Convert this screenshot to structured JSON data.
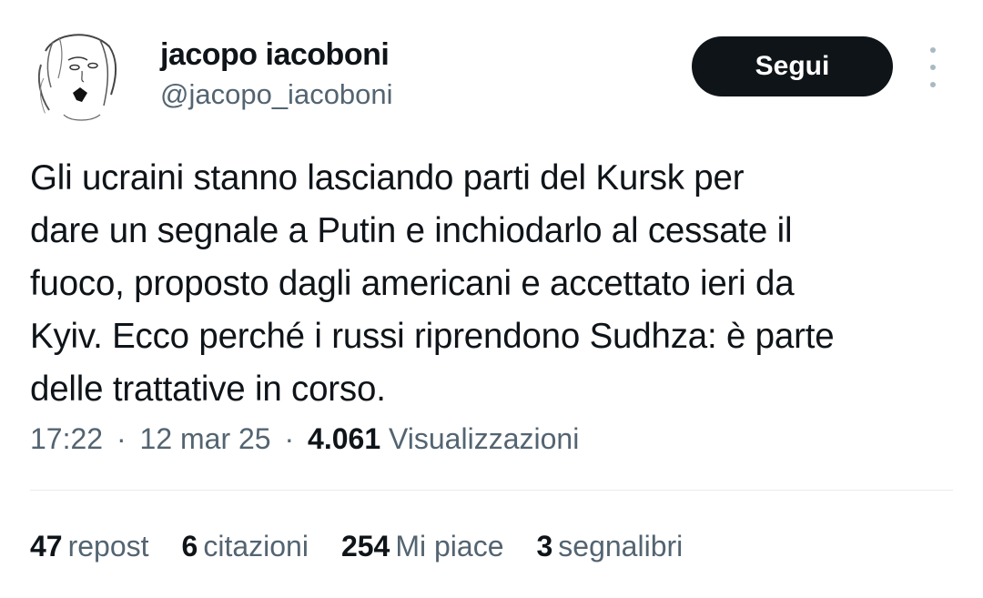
{
  "author": {
    "display_name": "jacopo iacoboni",
    "handle": "@jacopo_iacoboni"
  },
  "actions": {
    "follow_label": "Segui"
  },
  "tweet": {
    "lines": [
      "Gli ucraini stanno lasciando parti del Kursk per",
      "dare un segnale a Putin e inchiodarlo al cessate il",
      "fuoco, proposto dagli americani e accettato ieri da",
      "Kyiv. Ecco perché i russi riprendono Sudhza: è parte",
      "delle trattative in corso."
    ]
  },
  "meta": {
    "time": "17:22",
    "separator": "·",
    "date": "12 mar 25",
    "views_count": "4.061",
    "views_label": "Visualizzazioni"
  },
  "stats": {
    "reposts": {
      "count": "47",
      "label": "repost"
    },
    "quotes": {
      "count": "6",
      "label": "citazioni"
    },
    "likes": {
      "count": "254",
      "label": "Mi piace"
    },
    "bookmarks": {
      "count": "3",
      "label": "segnalibri"
    }
  },
  "icons": {
    "more": "more-vertical-icon"
  }
}
